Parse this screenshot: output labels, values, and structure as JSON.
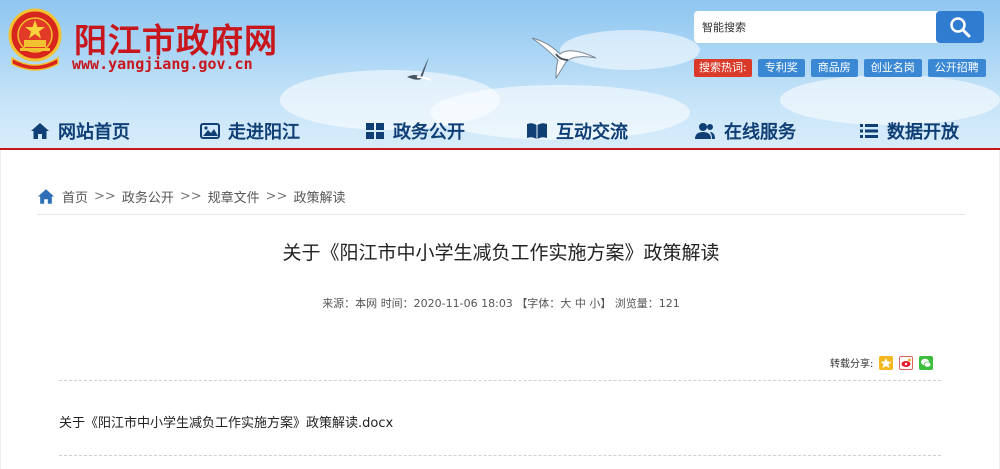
{
  "header": {
    "site_title": "阳江市政府网",
    "site_url": "www.yangjiang.gov.cn",
    "search": {
      "placeholder": "智能搜索"
    },
    "hot_label": "搜索热词:",
    "hot_tags": [
      "专利奖",
      "商品房",
      "创业名岗",
      "公开招聘"
    ]
  },
  "nav": [
    {
      "label": "网站首页",
      "icon": "home-icon"
    },
    {
      "label": "走进阳江",
      "icon": "picture-icon"
    },
    {
      "label": "政务公开",
      "icon": "grid-icon"
    },
    {
      "label": "互动交流",
      "icon": "book-icon"
    },
    {
      "label": "在线服务",
      "icon": "users-icon"
    },
    {
      "label": "数据开放",
      "icon": "list-icon"
    }
  ],
  "breadcrumb": {
    "items": [
      "首页",
      "政务公开",
      "规章文件",
      "政策解读"
    ],
    "separator": ">>"
  },
  "article": {
    "title": "关于《阳江市中小学生减负工作实施方案》政策解读",
    "meta": {
      "source": "来源：本网",
      "time": "时间：2020-11-06 18:03",
      "font_open": "【字体：",
      "font_large": "大",
      "font_medium": "中",
      "font_small": "小",
      "font_close": "】",
      "views": "浏览量：121"
    },
    "share_label": "转载分享:",
    "share_icons": [
      "qzone-icon",
      "weibo-icon",
      "wechat-icon"
    ],
    "attachment": "关于《阳江市中小学生减负工作实施方案》政策解读.docx"
  },
  "colors": {
    "brand_red": "#c8161d",
    "nav_text": "#0f3f75",
    "search_button": "#2f7cd0",
    "hot_tag": "#3a88d3",
    "hot_label": "#d93a2a"
  }
}
